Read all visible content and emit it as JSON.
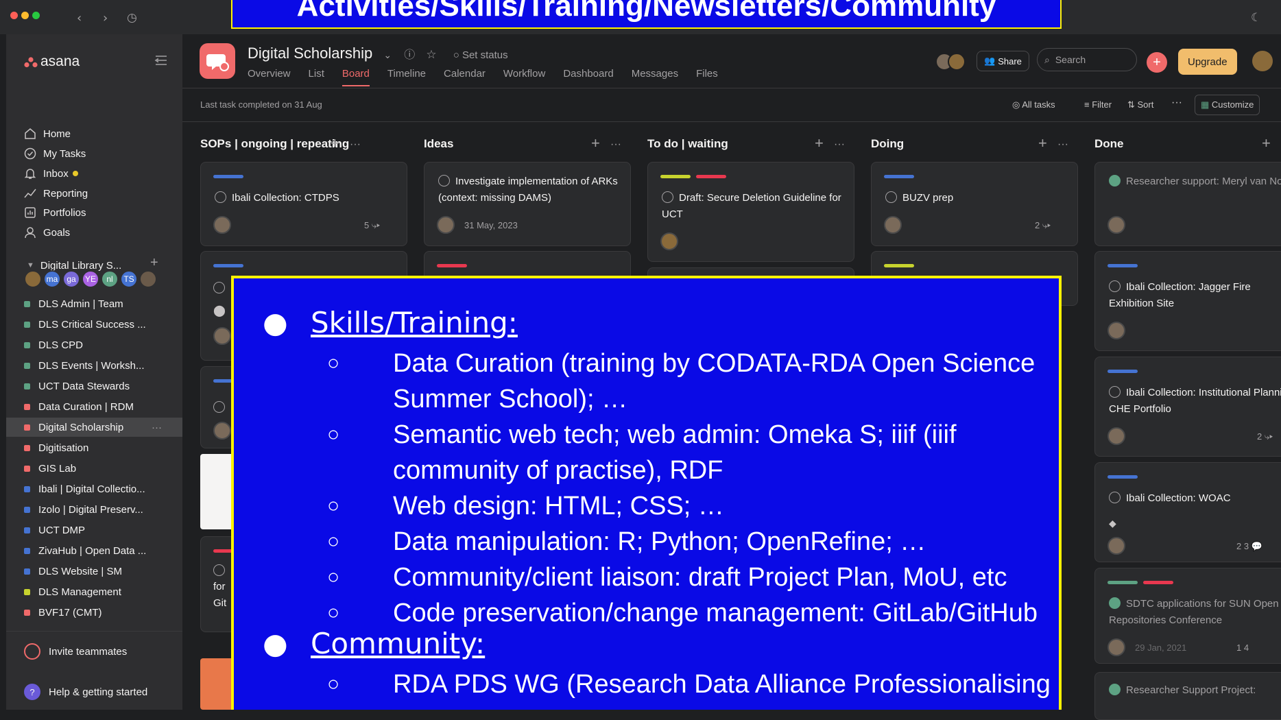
{
  "app": {
    "logo": "asana"
  },
  "sidebar": {
    "nav": [
      {
        "label": "Home",
        "icon": "home-icon"
      },
      {
        "label": "My Tasks",
        "icon": "check-circle-icon"
      },
      {
        "label": "Inbox",
        "icon": "bell-icon"
      },
      {
        "label": "Reporting",
        "icon": "chart-line-icon"
      },
      {
        "label": "Portfolios",
        "icon": "folder-icon"
      },
      {
        "label": "Goals",
        "icon": "person-icon"
      }
    ],
    "team": {
      "label": "Digital Library S...",
      "members": [
        "ma",
        "ga",
        "YE",
        "nl",
        "TS"
      ]
    },
    "projects": [
      {
        "label": "DLS Admin | Team",
        "color": "#5da283"
      },
      {
        "label": "DLS Critical Success ...",
        "color": "#5da283"
      },
      {
        "label": "DLS CPD",
        "color": "#5da283"
      },
      {
        "label": "DLS Events | Worksh...",
        "color": "#5da283"
      },
      {
        "label": "UCT Data Stewards",
        "color": "#5da283"
      },
      {
        "label": "Data Curation | RDM",
        "color": "#f06a6a"
      },
      {
        "label": "Digital Scholarship",
        "color": "#f06a6a"
      },
      {
        "label": "Digitisation",
        "color": "#f06a6a"
      },
      {
        "label": "GIS Lab",
        "color": "#f06a6a"
      },
      {
        "label": "Ibali | Digital Collectio...",
        "color": "#4573d2"
      },
      {
        "label": "Izolo | Digital Preserv...",
        "color": "#4573d2"
      },
      {
        "label": "UCT DMP",
        "color": "#4573d2"
      },
      {
        "label": "ZivaHub | Open Data ...",
        "color": "#4573d2"
      },
      {
        "label": "DLS Website | SM",
        "color": "#4573d2"
      },
      {
        "label": "DLS Management",
        "color": "#c7d32e"
      },
      {
        "label": "BVF17 (CMT)",
        "color": "#f06a6a"
      }
    ],
    "invite": "Invite teammates",
    "help": "Help & getting started"
  },
  "header": {
    "project_title": "Digital Scholarship",
    "set_status": "Set status",
    "tabs": [
      "Overview",
      "List",
      "Board",
      "Timeline",
      "Calendar",
      "Workflow",
      "Dashboard",
      "Messages",
      "Files"
    ],
    "active_tab": "Board",
    "share": "Share",
    "search_placeholder": "Search",
    "upgrade": "Upgrade"
  },
  "toolbar": {
    "last_completed": "Last task completed on 31 Aug",
    "all_tasks": "All tasks",
    "filter": "Filter",
    "sort": "Sort",
    "customize": "Customize"
  },
  "columns": [
    {
      "title": "SOPs | ongoing | repeating"
    },
    {
      "title": "Ideas"
    },
    {
      "title": "To do | waiting"
    },
    {
      "title": "Doing"
    },
    {
      "title": "Done"
    }
  ],
  "cards": {
    "c1": {
      "text": "Ibali Collection: CTDPS",
      "meta": "5"
    },
    "c2": {
      "text": "Investigate implementation of ARKs (context: missing DAMS)",
      "date": "31 May, 2023"
    },
    "c3": {
      "text": "Draft: Secure Deletion Guideline for UCT"
    },
    "c4": {
      "text": "BUZV prep",
      "meta": "2"
    },
    "d1": {
      "text": "Researcher support: Meryl van Noie"
    },
    "d2": {
      "text": "Ibali Collection: Jagger Fire Exhibition Site"
    },
    "d3": {
      "text": "Ibali Collection: Institutional Planning CHE Portfolio",
      "meta": "2"
    },
    "d4": {
      "text": "Ibali Collection: WOAC",
      "meta": "2  3"
    },
    "d5": {
      "text": "SDTC applications for SUN Open Repositories Conference",
      "date": "29 Jan, 2021",
      "meta": "1  4"
    },
    "d6": {
      "text": "Researcher Support Project:"
    },
    "partial": {
      "for": "for",
      "git": "Git"
    }
  },
  "overlay": {
    "banner": "Activities/Skills/Training/Newsletters/Community",
    "sections": [
      {
        "heading": "Skills/Training",
        "items": [
          "Data Curation (training by CODATA-RDA Open Science Summer School); …",
          "Semantic web tech; web admin: Omeka S; iiif (iiif community of practise), RDF",
          "Web design: HTML; CSS; …",
          "Data manipulation: R; Python; OpenRefine;  …",
          "Community/client liaison: draft Project Plan, MoU, etc",
          "Code preservation/change management: GitLab/GitHub"
        ]
      },
      {
        "heading": "Community",
        "items": [
          "RDA PDS WG (Research Data Alliance Professionalising"
        ]
      }
    ]
  }
}
